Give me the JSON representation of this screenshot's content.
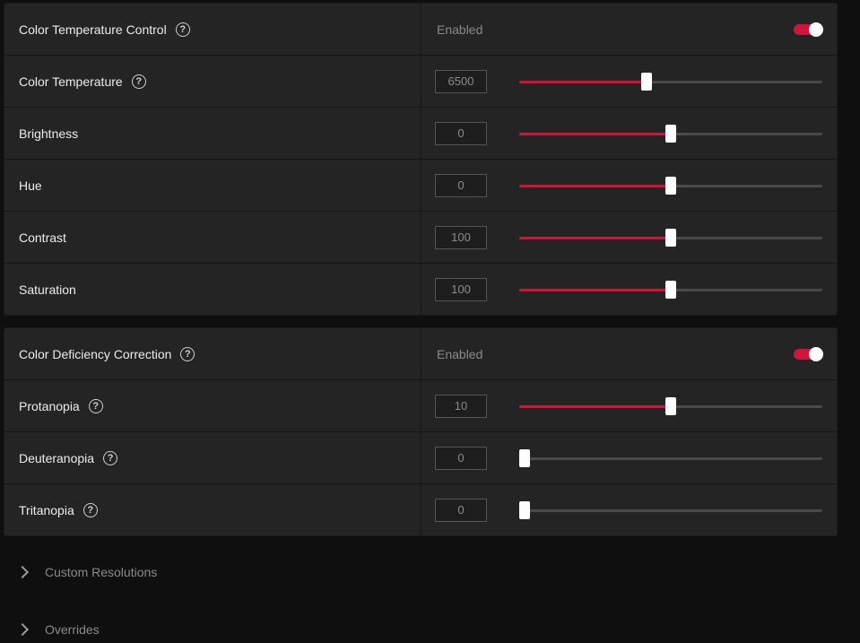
{
  "group1": {
    "header": {
      "label": "Color Temperature Control",
      "status": "Enabled",
      "enabled": true
    },
    "rows": [
      {
        "label": "Color Temperature",
        "value": "6500",
        "fraction": 0.42,
        "help": true
      },
      {
        "label": "Brightness",
        "value": "0",
        "fraction": 0.5,
        "help": false
      },
      {
        "label": "Hue",
        "value": "0",
        "fraction": 0.5,
        "help": false
      },
      {
        "label": "Contrast",
        "value": "100",
        "fraction": 0.5,
        "help": false
      },
      {
        "label": "Saturation",
        "value": "100",
        "fraction": 0.5,
        "help": false
      }
    ]
  },
  "group2": {
    "header": {
      "label": "Color Deficiency Correction",
      "status": "Enabled",
      "enabled": true
    },
    "rows": [
      {
        "label": "Protanopia",
        "value": "10",
        "fraction": 0.5,
        "help": true
      },
      {
        "label": "Deuteranopia",
        "value": "0",
        "fraction": 0.0,
        "help": true
      },
      {
        "label": "Tritanopia",
        "value": "0",
        "fraction": 0.0,
        "help": true
      }
    ]
  },
  "collapsed": [
    {
      "label": "Custom Resolutions"
    },
    {
      "label": "Overrides"
    }
  ],
  "help_glyph": "?",
  "colors": {
    "accent": "#d2143a",
    "panel": "#242424",
    "background": "#0f0f0f"
  }
}
